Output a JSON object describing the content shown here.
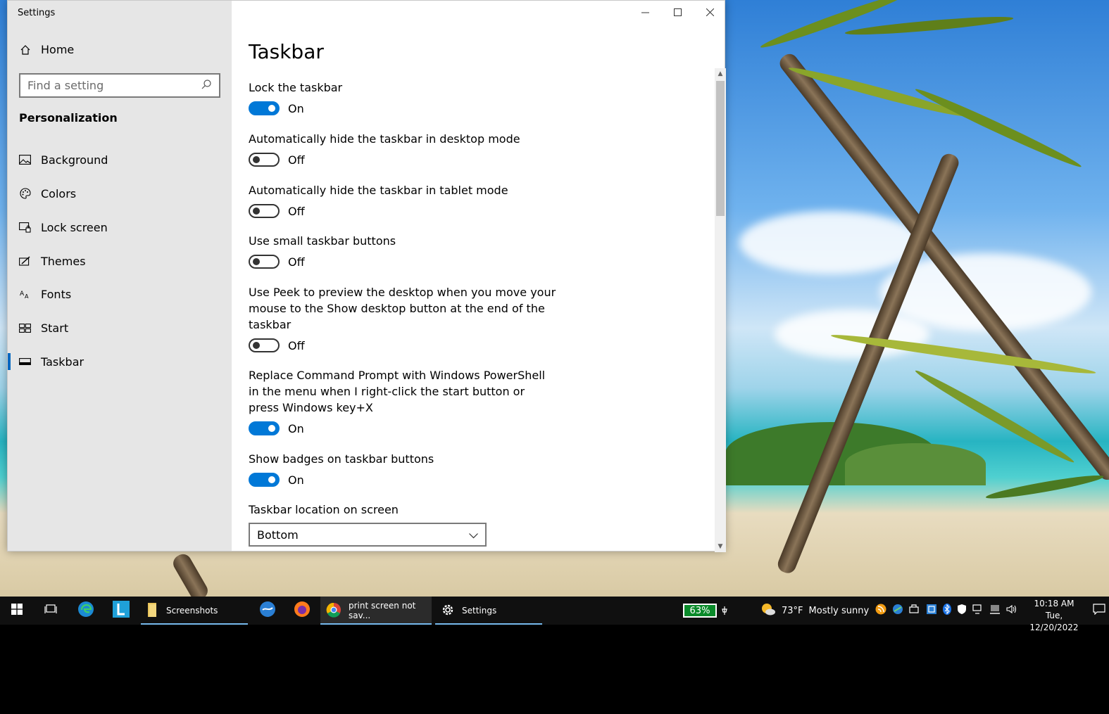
{
  "window": {
    "title": "Settings",
    "minimize_icon": "minimize-icon",
    "maximize_icon": "maximize-icon",
    "close_icon": "close-icon"
  },
  "sidebar": {
    "home_label": "Home",
    "search_placeholder": "Find a setting",
    "section_heading": "Personalization",
    "items": [
      {
        "label": "Background",
        "icon": "picture-icon"
      },
      {
        "label": "Colors",
        "icon": "palette-icon"
      },
      {
        "label": "Lock screen",
        "icon": "lock-screen-icon"
      },
      {
        "label": "Themes",
        "icon": "themes-icon"
      },
      {
        "label": "Fonts",
        "icon": "fonts-icon"
      },
      {
        "label": "Start",
        "icon": "start-icon"
      },
      {
        "label": "Taskbar",
        "icon": "taskbar-icon",
        "selected": true
      }
    ]
  },
  "content": {
    "title": "Taskbar",
    "settings": [
      {
        "label": "Lock the taskbar",
        "state": "On"
      },
      {
        "label": "Automatically hide the taskbar in desktop mode",
        "state": "Off"
      },
      {
        "label": "Automatically hide the taskbar in tablet mode",
        "state": "Off"
      },
      {
        "label": "Use small taskbar buttons",
        "state": "Off"
      },
      {
        "label": "Use Peek to preview the desktop when you move your mouse to the Show desktop button at the end of the taskbar",
        "state": "Off"
      },
      {
        "label": "Replace Command Prompt with Windows PowerShell in the menu when I right-click the start button or press Windows key+X",
        "state": "On"
      },
      {
        "label": "Show badges on taskbar buttons",
        "state": "On"
      }
    ],
    "location_label": "Taskbar location on screen",
    "location_value": "Bottom"
  },
  "taskbar": {
    "apps": [
      {
        "label": "Screenshots",
        "icon": "folder-icon"
      },
      {
        "label": "print screen not sav...",
        "icon": "chrome-icon"
      },
      {
        "label": "Settings",
        "icon": "gear-icon"
      }
    ],
    "battery": "63%",
    "weather_temp": "73°F",
    "weather_desc": "Mostly sunny",
    "time": "10:18 AM",
    "date": "Tue, 12/20/2022"
  },
  "colors": {
    "accent": "#0078d7",
    "taskbar_bg": "#101010",
    "sidebar_bg": "#e6e6e6"
  }
}
